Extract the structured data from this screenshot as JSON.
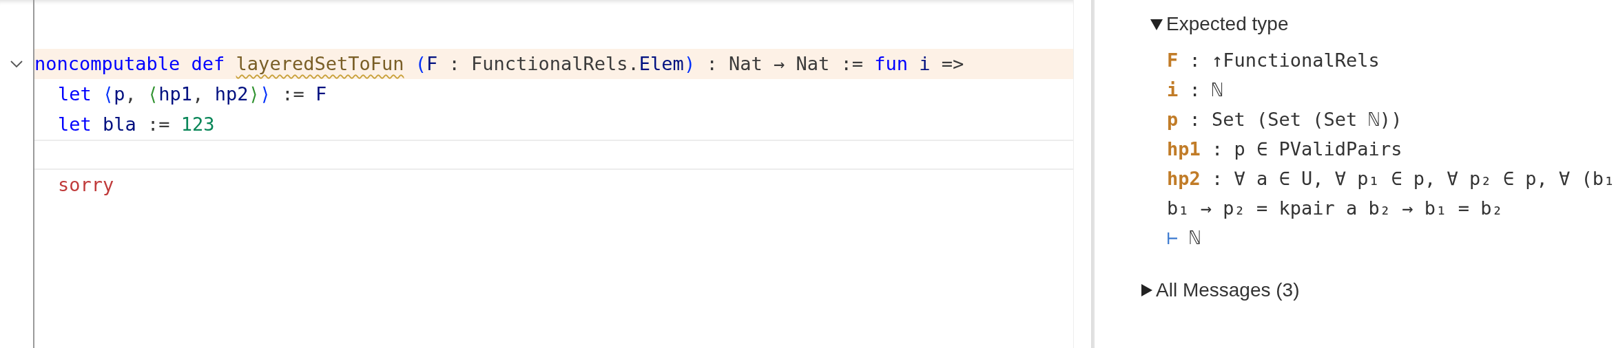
{
  "editor": {
    "lines": [
      {
        "fold": {
          "expanded": true
        },
        "highlighted": true,
        "current": false,
        "tokens": [
          {
            "kind": "keyword",
            "text": "noncomputable def "
          },
          {
            "kind": "decl",
            "text": "layeredSetToFun",
            "warning": true
          },
          {
            "kind": "paren",
            "text": " ("
          },
          {
            "kind": "ident",
            "text": "F"
          },
          {
            "kind": "plain",
            "text": " : FunctionalRels."
          },
          {
            "kind": "ident",
            "text": "Elem"
          },
          {
            "kind": "paren",
            "text": ")"
          },
          {
            "kind": "plain",
            "text": " : Nat → Nat := "
          },
          {
            "kind": "keyword",
            "text": "fun "
          },
          {
            "kind": "ident",
            "text": "i"
          },
          {
            "kind": "plain",
            "text": " =>"
          }
        ],
        "children": [
          {
            "highlighted": false,
            "current": false,
            "tokens": [
              {
                "kind": "keyword",
                "text": "let "
              },
              {
                "kind": "paren",
                "text": "⟨"
              },
              {
                "kind": "ident",
                "text": "p"
              },
              {
                "kind": "plain",
                "text": ", "
              },
              {
                "kind": "bracket2",
                "text": "⟨"
              },
              {
                "kind": "ident",
                "text": "hp1"
              },
              {
                "kind": "plain",
                "text": ", "
              },
              {
                "kind": "ident",
                "text": "hp2"
              },
              {
                "kind": "bracket2",
                "text": "⟩"
              },
              {
                "kind": "paren",
                "text": "⟩"
              },
              {
                "kind": "plain",
                "text": " := "
              },
              {
                "kind": "ident",
                "text": "F"
              }
            ]
          },
          {
            "highlighted": false,
            "current": false,
            "tokens": [
              {
                "kind": "keyword",
                "text": "let "
              },
              {
                "kind": "ident",
                "text": "bla"
              },
              {
                "kind": "plain",
                "text": " := "
              },
              {
                "kind": "number",
                "text": "123"
              }
            ]
          },
          {
            "highlighted": false,
            "current": true
          },
          {
            "highlighted": false,
            "current": false,
            "tokens": [
              {
                "kind": "sorry",
                "text": "sorry"
              }
            ]
          }
        ]
      }
    ]
  },
  "infoview": {
    "sections": [
      {
        "title": "Expected type",
        "expanded": true,
        "hypotheses": [
          {
            "name": "F",
            "type_lines": [
              ": ↑FunctionalRels"
            ]
          },
          {
            "name": "i",
            "type_lines": [
              ": ℕ"
            ]
          },
          {
            "name": "p",
            "type_lines": [
              ": Set (Set (Set ℕ))"
            ]
          },
          {
            "name": "hp1",
            "type_lines": [
              ": p ∈ PValidPairs"
            ]
          },
          {
            "name": "hp2",
            "type_lines": [
              ": ∀ a ∈ U, ∀ p₁ ∈ p, ∀ p₂ ∈ p, ∀ (b₁",
              "b₁ → p₂ = kpair a b₂ → b₁ = b₂"
            ]
          }
        ],
        "goal": {
          "turnstile": "⊢",
          "type": "ℕ"
        }
      },
      {
        "title": "All Messages (3)",
        "expanded": false
      }
    ]
  }
}
